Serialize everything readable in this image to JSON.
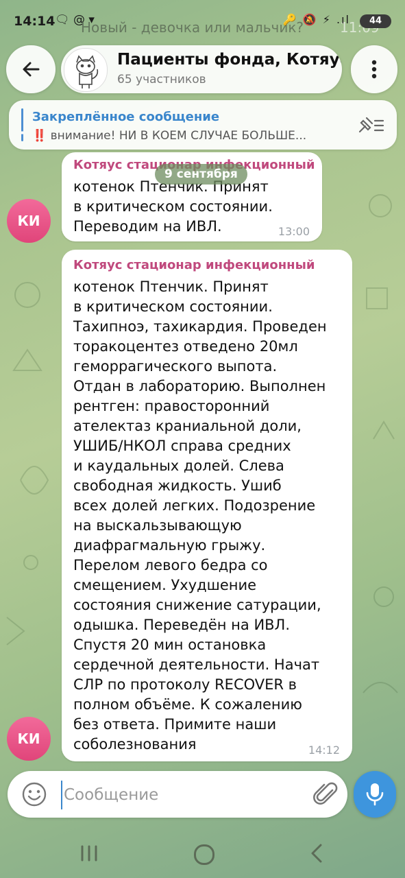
{
  "status_bar": {
    "time": "14:14",
    "left_icons": "🗨 @ ▾",
    "right_icons": "🔑 🔕 ⚡ .ıl",
    "battery": "44"
  },
  "notification_preview": {
    "text": "Новый - девочка или мальчик?",
    "time": "11:09"
  },
  "header": {
    "back_icon": "arrow-left-icon",
    "title": "Пациенты фонда, Котяус",
    "subtitle": "65 участников",
    "menu_icon": "vertical-dots-icon"
  },
  "pinned": {
    "title": "Закреплённое сообщение",
    "prefix": "‼️",
    "text": "внимание! НИ В КОЕМ СЛУЧАЕ БОЛЬШЕ..."
  },
  "date_separator": "9 сентября",
  "messages": [
    {
      "sender": "Котяус стационар инфекционный",
      "text": "котенок Птенчик. Принят\nв критическом состоянии.\nПереводим на ИВЛ.",
      "time": "13:00",
      "avatar_initials": "КИ"
    },
    {
      "sender": "Котяус стационар инфекционный",
      "text": "котенок Птенчик. Принят\nв критическом состоянии.\nТахипноэ, тахикардия. Проведен\nторакоцентез отведено 20мл\nгеморрагического выпота.\nОтдан в лабораторию. Выполнен\nрентген: правосторонний\nателектаз краниальной доли,\nУШИБ/НКОЛ справа средних\nи каудальных долей. Слева\nсвободная жидкость. Ушиб\nвсех долей легких. Подозрение\nна выскальзывающую\nдиафрагмальную грыжу.\nПерелом левого бедра со\nсмещением. Ухудшение\nсостояния снижение сатурации,\nодышка. Переведён на ИВЛ.\nСпустя 20 мин остановка\nсердечной деятельности. Начат\nСЛР по протоколу RECOVER в\nполном объёме. К сожалению\nбез ответа. Примите наши\nсоболезнования",
      "time": "14:12",
      "avatar_initials": "КИ"
    }
  ],
  "composer": {
    "placeholder": "Сообщение",
    "emoji_icon": "smiley-icon",
    "attach_icon": "paperclip-icon",
    "mic_icon": "microphone-icon"
  },
  "colors": {
    "accent": "#3e95dd",
    "sender": "#c0497d",
    "avatar": "#e0457a"
  }
}
